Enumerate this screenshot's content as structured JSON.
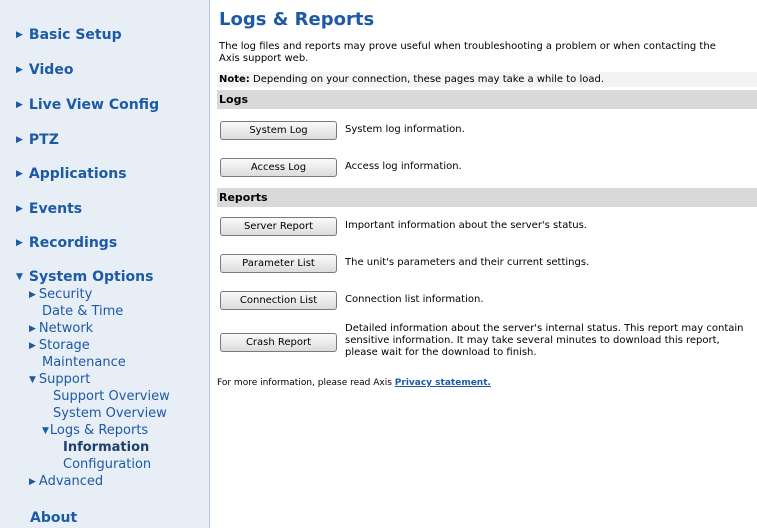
{
  "sidebar": {
    "top_items": [
      {
        "label": "Basic Setup",
        "icon": "triangle-right"
      },
      {
        "label": "Video",
        "icon": "triangle-right"
      },
      {
        "label": "Live View Config",
        "icon": "triangle-right"
      },
      {
        "label": "PTZ",
        "icon": "triangle-right"
      },
      {
        "label": "Applications",
        "icon": "triangle-right"
      },
      {
        "label": "Events",
        "icon": "triangle-right"
      },
      {
        "label": "Recordings",
        "icon": "triangle-right"
      },
      {
        "label": "System Options",
        "icon": "triangle-down"
      }
    ],
    "system_options": {
      "security": "Security",
      "date_time": "Date & Time",
      "network": "Network",
      "storage": "Storage",
      "maintenance": "Maintenance",
      "support": "Support",
      "support_overview": "Support Overview",
      "system_overview": "System Overview",
      "logs_reports": "Logs & Reports",
      "information": "Information",
      "configuration": "Configuration",
      "advanced": "Advanced"
    },
    "about": "About"
  },
  "main": {
    "title": "Logs & Reports",
    "intro": "The log files and reports may prove useful when troubleshooting a problem or when contacting the Axis support web.",
    "note_label": "Note:",
    "note_text": " Depending on your connection, these pages may take a while to load.",
    "logs_heading": "Logs",
    "logs": [
      {
        "button": "System Log",
        "description": "System log information."
      },
      {
        "button": "Access Log",
        "description": "Access log information."
      }
    ],
    "reports_heading": "Reports",
    "reports": [
      {
        "button": "Server Report",
        "description": "Important information about the server's status."
      },
      {
        "button": "Parameter List",
        "description": "The unit's parameters and their current settings."
      },
      {
        "button": "Connection List",
        "description": "Connection list information."
      },
      {
        "button": "Crash Report",
        "description": "Detailed information about the server's internal status. This report may contain sensitive information. It may take several minutes to download this report, please wait for the download to finish."
      }
    ],
    "footer_text": "For more information, please read Axis ",
    "privacy_link": "Privacy statement."
  },
  "colors": {
    "link_blue": "#1d5aa6",
    "sidebar_bg": "#e8eef6",
    "section_bar": "#d9d9d9"
  }
}
